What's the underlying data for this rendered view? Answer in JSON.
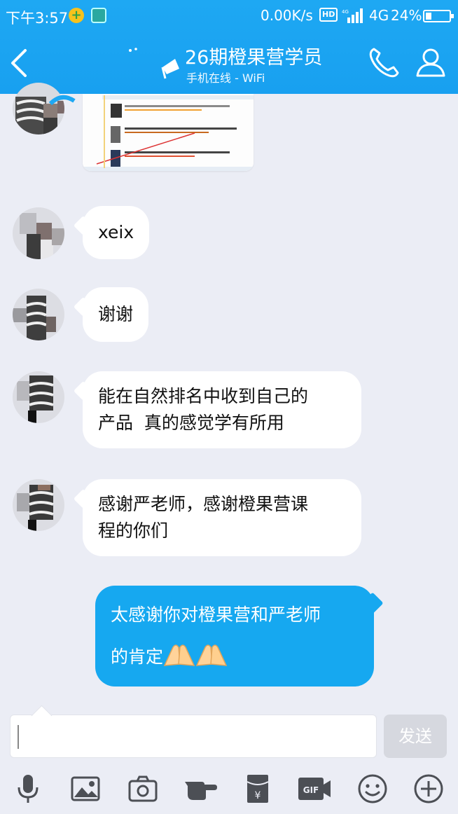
{
  "status_bar": {
    "time": "下午3:57",
    "net_speed": "0.00K/s",
    "hd_badge": "HD",
    "network_type": "4G",
    "battery_text": "24%",
    "battery_level": 0.24
  },
  "header": {
    "title": "26期橙果营学员",
    "subtitle": "手机在线 - WiFi"
  },
  "messages": [
    {
      "side": "left",
      "kind": "image"
    },
    {
      "side": "left",
      "kind": "text",
      "text": "xeix"
    },
    {
      "side": "left",
      "kind": "text",
      "text": "谢谢"
    },
    {
      "side": "left",
      "kind": "text",
      "lines": [
        "能在自然排名中收到自己的",
        "产品  真的感觉学有所用"
      ]
    },
    {
      "side": "left",
      "kind": "text",
      "lines": [
        "感谢严老师，感谢橙果营课",
        "程的你们"
      ]
    },
    {
      "side": "right",
      "kind": "text",
      "lines": [
        "太感谢你对橙果营和严老师",
        "的肯定"
      ],
      "emoji": [
        "folded-hands",
        "folded-hands"
      ]
    }
  ],
  "composer": {
    "value": "",
    "send_label": "发送"
  },
  "toolbar": [
    "microphone-icon",
    "image-icon",
    "camera-icon",
    "poke-icon",
    "red-packet-icon",
    "gif-icon",
    "emoji-icon",
    "plus-icon"
  ],
  "colors": {
    "header_blue": "#1ea8f3",
    "bubble_blue": "#16a8f0",
    "background": "#ebedf5",
    "send_disabled": "#d6d8df"
  }
}
